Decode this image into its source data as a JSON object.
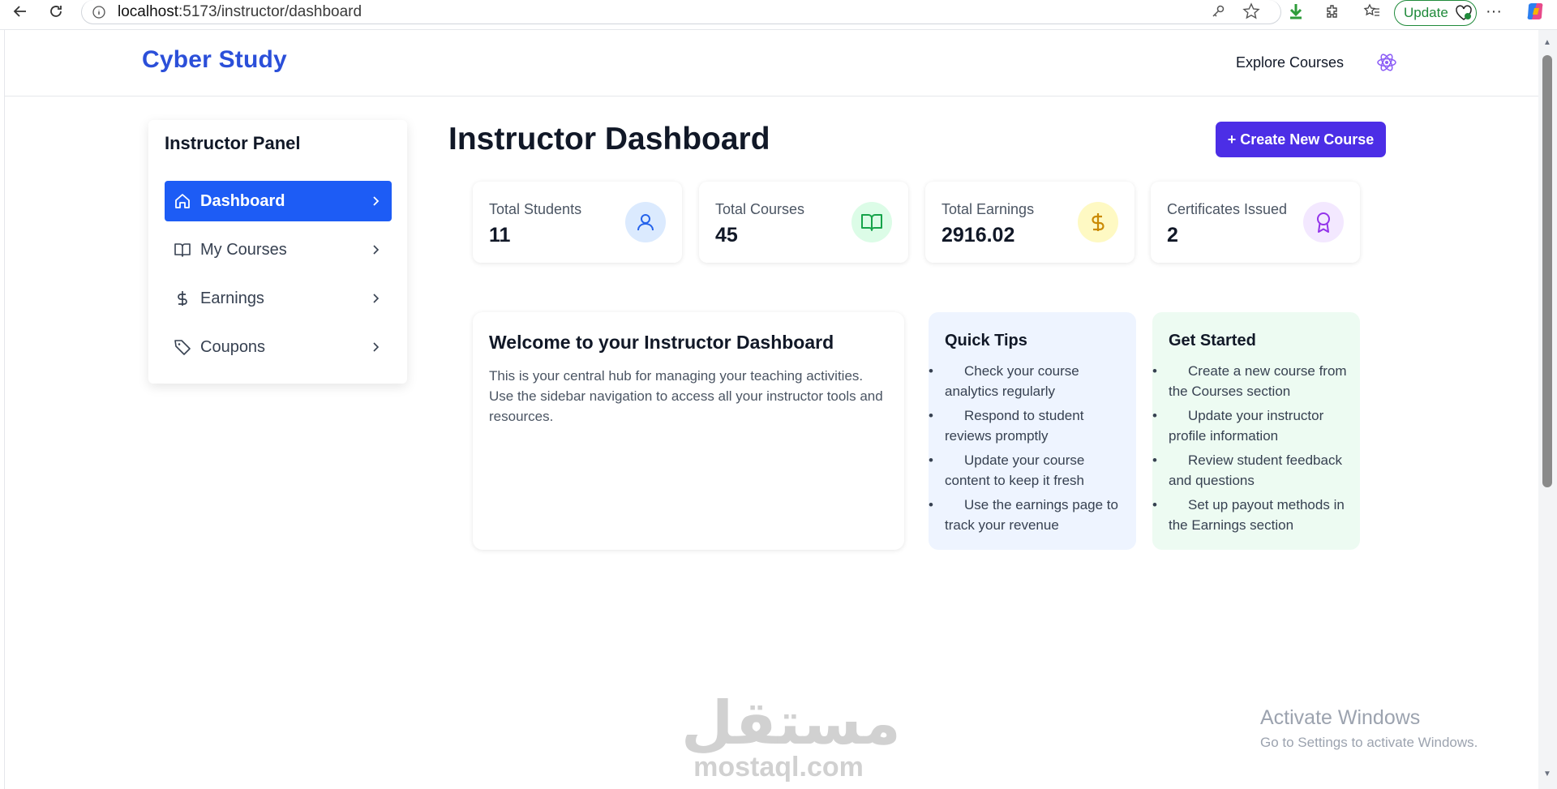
{
  "browser": {
    "url_host": "localhost",
    "url_rest": ":5173/instructor/dashboard",
    "update_label": "Update",
    "more_label": "···"
  },
  "header": {
    "logo": "Cyber Study",
    "explore_label": "Explore Courses"
  },
  "sidebar": {
    "title": "Instructor Panel",
    "items": [
      {
        "label": "Dashboard",
        "icon": "home-icon",
        "active": true
      },
      {
        "label": "My Courses",
        "icon": "book-icon",
        "active": false
      },
      {
        "label": "Earnings",
        "icon": "dollar-icon",
        "active": false
      },
      {
        "label": "Coupons",
        "icon": "tag-icon",
        "active": false
      }
    ]
  },
  "main": {
    "title": "Instructor Dashboard",
    "create_label": "+ Create New Course",
    "stats": [
      {
        "label": "Total Students",
        "value": "11",
        "icon": "user-icon",
        "color": "#2563eb",
        "bg": "#dbeafe"
      },
      {
        "label": "Total Courses",
        "value": "45",
        "icon": "book-open-icon",
        "color": "#16a34a",
        "bg": "#dcfce7"
      },
      {
        "label": "Total Earnings",
        "value": "2916.02",
        "icon": "dollar-icon",
        "color": "#ca8a04",
        "bg": "#fef9c3"
      },
      {
        "label": "Certificates Issued",
        "value": "2",
        "icon": "award-icon",
        "color": "#9333ea",
        "bg": "#f3e8ff"
      }
    ],
    "welcome": {
      "title": "Welcome to your Instructor Dashboard",
      "text": "This is your central hub for managing your teaching activities. Use the sidebar navigation to access all your instructor tools and resources."
    },
    "quick_tips": {
      "title": "Quick Tips",
      "items": [
        "Check your course analytics regularly",
        "Respond to student reviews promptly",
        "Update your course content to keep it fresh",
        "Use the earnings page to track your revenue"
      ]
    },
    "get_started": {
      "title": "Get Started",
      "items": [
        "Create a new course from the Courses section",
        "Update your instructor profile information",
        "Review student feedback and questions",
        "Set up payout methods in the Earnings section"
      ]
    }
  },
  "overlay": {
    "watermark_arabic": "مستقل",
    "watermark_latin": "mostaql.com",
    "activate_title": "Activate Windows",
    "activate_sub": "Go to Settings to activate Windows."
  },
  "colors": {
    "brand": "#2b4fd9",
    "active_nav": "#1d5cf5",
    "primary_button": "#4c2ee6"
  }
}
